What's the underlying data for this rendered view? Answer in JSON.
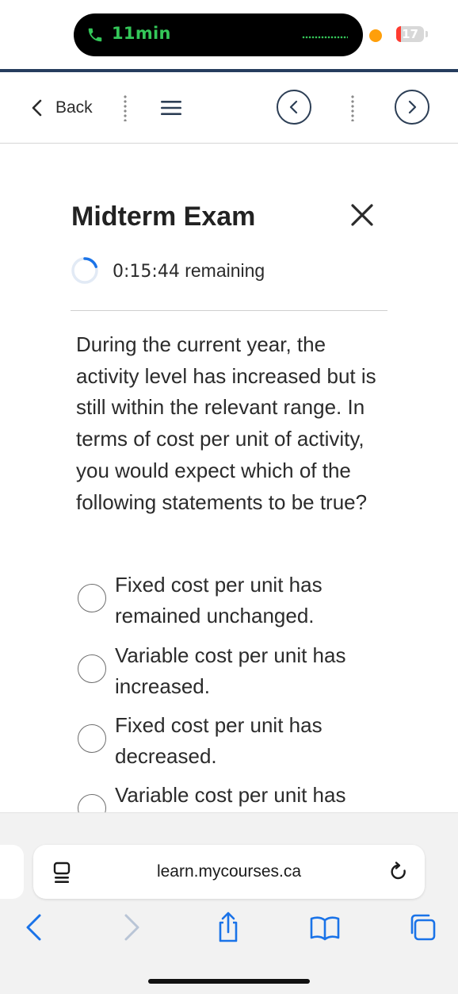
{
  "status_bar": {
    "call_time": "11min",
    "battery_level": "17",
    "battery_fraction": 0.17,
    "colors": {
      "call": "#34c759",
      "recording_dot": "#ff9f0a",
      "battery_low": "#ff3b30"
    }
  },
  "toolbar": {
    "back_label": "Back",
    "icons": [
      "chevron-left-icon",
      "menu-icon",
      "previous-icon",
      "next-icon"
    ]
  },
  "exam": {
    "title": "Midterm Exam",
    "timer_value": "0:15:44",
    "timer_suffix": "remaining",
    "question": "During the current year, the activity level has increased but is still within the relevant range. In terms of cost per unit of activity, you would expect which of the following statements to be true?",
    "options": [
      {
        "label": "Fixed cost per unit has remained unchanged.",
        "selected": false
      },
      {
        "label": "Variable cost per unit has increased.",
        "selected": false
      },
      {
        "label": "Fixed cost per unit has decreased.",
        "selected": false
      },
      {
        "label": "Variable cost per unit has",
        "selected": false
      }
    ]
  },
  "browser": {
    "url": "learn.mycourses.ca",
    "accent_color": "#1a73e8",
    "nav_icons": [
      "back-icon",
      "forward-icon",
      "share-icon",
      "bookmarks-icon",
      "tabs-icon"
    ]
  }
}
